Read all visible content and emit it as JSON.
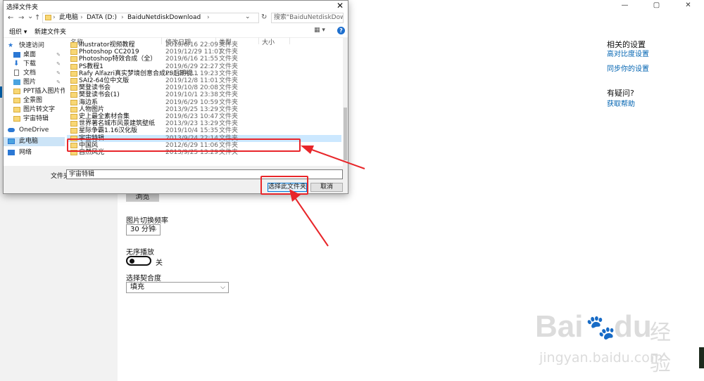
{
  "dialog": {
    "title": "选择文件夹",
    "close_glyph": "✕",
    "nav": {
      "back": "←",
      "forward": "→",
      "down": "⌄",
      "up": "↑",
      "refresh": "↻"
    },
    "address": {
      "parts": [
        "此电脑",
        "DATA (D:)",
        "BaiduNetdiskDownload"
      ],
      "sep": "›",
      "dropdown": "⌄"
    },
    "search_placeholder": "搜索\"BaiduNetdiskDownlo...",
    "toolbar": {
      "organize": "组织 ▾",
      "new_folder": "新建文件夹",
      "view": "▦ ▾",
      "help": "?"
    },
    "nav_pane": [
      {
        "label": "快速访问",
        "icon": "star-icon",
        "color": "#2b78d4"
      },
      {
        "label": "桌面",
        "icon": "desktop-icon",
        "color": "#2b78d4",
        "pin": "📌"
      },
      {
        "label": "下载",
        "icon": "download-icon",
        "color": "#2b78d4",
        "pin": "📌"
      },
      {
        "label": "文档",
        "icon": "document-icon",
        "color": "#6a6a6a",
        "pin": "📌"
      },
      {
        "label": "图片",
        "icon": "picture-icon",
        "color": "#2b78d4",
        "pin": "📌"
      },
      {
        "label": "PPT插入图片作为背",
        "icon": "folder-icon",
        "color": "#f8d775"
      },
      {
        "label": "全景图",
        "icon": "folder-icon",
        "color": "#f8d775"
      },
      {
        "label": "图片转文字",
        "icon": "folder-icon",
        "color": "#f8d775"
      },
      {
        "label": "宇宙特辑",
        "icon": "folder-icon",
        "color": "#f8d775"
      },
      {
        "label": "OneDrive",
        "icon": "cloud-icon",
        "color": "#2b78d4"
      },
      {
        "label": "此电脑",
        "icon": "computer-icon",
        "color": "#2b78d4"
      },
      {
        "label": "网络",
        "icon": "network-icon",
        "color": "#2b78d4"
      }
    ],
    "columns": {
      "name": "名称",
      "date": "修改日期",
      "type": "类型",
      "size": "大小"
    },
    "files": [
      {
        "name": "Illustrator视频教程",
        "date": "2019/6/16 22:09",
        "type": "文件夹"
      },
      {
        "name": "Photoshop CC2019",
        "date": "2019/12/29 11:07",
        "type": "文件夹"
      },
      {
        "name": "Photoshop特效合成（全）",
        "date": "2019/6/16 21:55",
        "type": "文件夹"
      },
      {
        "name": "PS教程1",
        "date": "2019/6/29 22:27",
        "type": "文件夹"
      },
      {
        "name": "Rafy Alfazri真实梦境创意合成PS后期视...",
        "date": "2019/7/11 19:23",
        "type": "文件夹"
      },
      {
        "name": "SAI2-64位中文版",
        "date": "2019/12/8 11:01",
        "type": "文件夹"
      },
      {
        "name": "樊登读书会",
        "date": "2019/10/8 20:08",
        "type": "文件夹"
      },
      {
        "name": "樊登读书会(1)",
        "date": "2019/10/1 23:38",
        "type": "文件夹"
      },
      {
        "name": "海边系",
        "date": "2019/6/29 10:59",
        "type": "文件夹"
      },
      {
        "name": "人物图片",
        "date": "2013/9/25 13:29",
        "type": "文件夹"
      },
      {
        "name": "史上最全素材合集",
        "date": "2019/6/23 10:47",
        "type": "文件夹"
      },
      {
        "name": "世界著名城市风景建筑壁纸",
        "date": "2013/9/23 13:29",
        "type": "文件夹"
      },
      {
        "name": "星际争霸1.16汉化版",
        "date": "2019/10/4 15:35",
        "type": "文件夹"
      },
      {
        "name": "宇宙特辑",
        "date": "2013/9/24 22:14",
        "type": "文件夹"
      },
      {
        "name": "中国风",
        "date": "2012/6/29 11:06",
        "type": "文件夹"
      },
      {
        "name": "自然风光",
        "date": "2013/9/25 13:29",
        "type": "文件夹"
      }
    ],
    "selected_file": "宇宙特辑",
    "footer": {
      "folder_label": "文件夹:",
      "folder_value": "宇宙特辑",
      "select_button": "选择此文件夹",
      "cancel_button": "取消"
    }
  },
  "background": {
    "window_controls": {
      "minimize": "—",
      "maximize": "▢",
      "close": "✕"
    },
    "related_settings": {
      "title": "相关的设置",
      "link1": "高对比度设置",
      "link2": "同步你的设置"
    },
    "question": {
      "title": "有疑问?",
      "link": "获取帮助"
    },
    "browse_button": "浏览",
    "freq": {
      "label": "图片切换频率",
      "value": "30 分钟"
    },
    "shuffle": {
      "label": "无序播放",
      "state": "关"
    },
    "fit": {
      "label": "选择契合度",
      "value": "填充"
    },
    "chevron": "⌵"
  },
  "watermark": {
    "brand": "Bai",
    "paw": "🐾",
    "brand2": "du",
    "cn": "经验",
    "url": "jingyan.baidu.com"
  },
  "colors": {
    "annotation_red": "#e8262a",
    "accent_blue": "#0063b1",
    "selection": "#cce8ff"
  }
}
